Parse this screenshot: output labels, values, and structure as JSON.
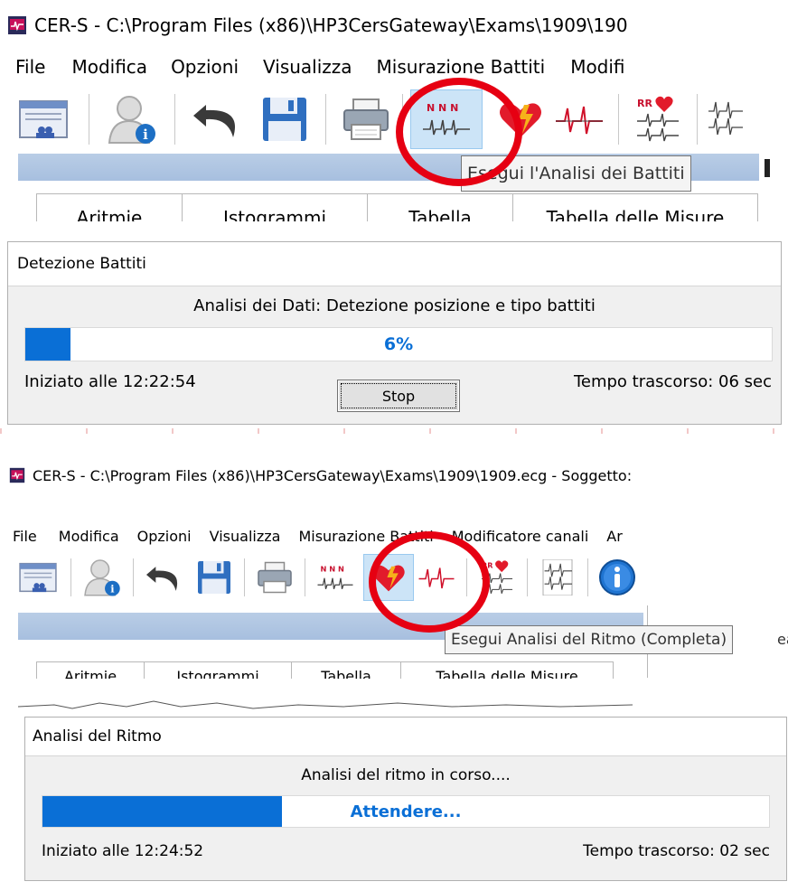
{
  "top": {
    "title": "CER-S - C:\\Program Files (x86)\\HP3CersGateway\\Exams\\1909\\190",
    "menu": [
      "File",
      "Modifica",
      "Opzioni",
      "Visualizza",
      "Misurazione Battiti",
      "Modifi"
    ],
    "tooltip": "Esegui l'Analisi dei Battiti",
    "tabs": [
      "Aritmie",
      "Istogrammi",
      "Tabella",
      "Tabella delle Misure"
    ]
  },
  "dialog1": {
    "title": "Detezione Battiti",
    "message": "Analisi dei Dati: Detezione posizione e tipo battiti",
    "progress_text": "6%",
    "progress_value": 0.06,
    "started": "Iniziato alle 12:22:54",
    "elapsed": "Tempo trascorso: 06 sec",
    "stop_label": "Stop"
  },
  "bottom": {
    "title": "CER-S - C:\\Program Files (x86)\\HP3CersGateway\\Exams\\1909\\1909.ecg - Soggetto:",
    "menu": [
      "File",
      "Modifica",
      "Opzioni",
      "Visualizza",
      "Misurazione Battiti",
      "Modificatore canali",
      "Ar"
    ],
    "tooltip": "Esegui Analisi del Ritmo (Completa)",
    "tooltip_overflow": "ea",
    "tabs": [
      "Aritmie",
      "Istogrammi",
      "Tabella",
      "Tabella delle Misure"
    ]
  },
  "dialog2": {
    "title": "Analisi del Ritmo",
    "message": "Analisi del ritmo in corso....",
    "progress_text": "Attendere...",
    "progress_value": 0.33,
    "started": "Iniziato alle 12:24:52",
    "elapsed": "Tempo trascorso: 02 sec"
  },
  "colors": {
    "highlight": "#e60012",
    "progress": "#0a6fd6"
  },
  "icons": [
    "patient-list-icon",
    "patient-info-icon",
    "undo-icon",
    "save-icon",
    "print-icon",
    "beat-analysis-icon",
    "rhythm-analysis-icon",
    "ecg-single-icon",
    "rr-analysis-icon",
    "multi-channel-icon",
    "info-icon"
  ]
}
